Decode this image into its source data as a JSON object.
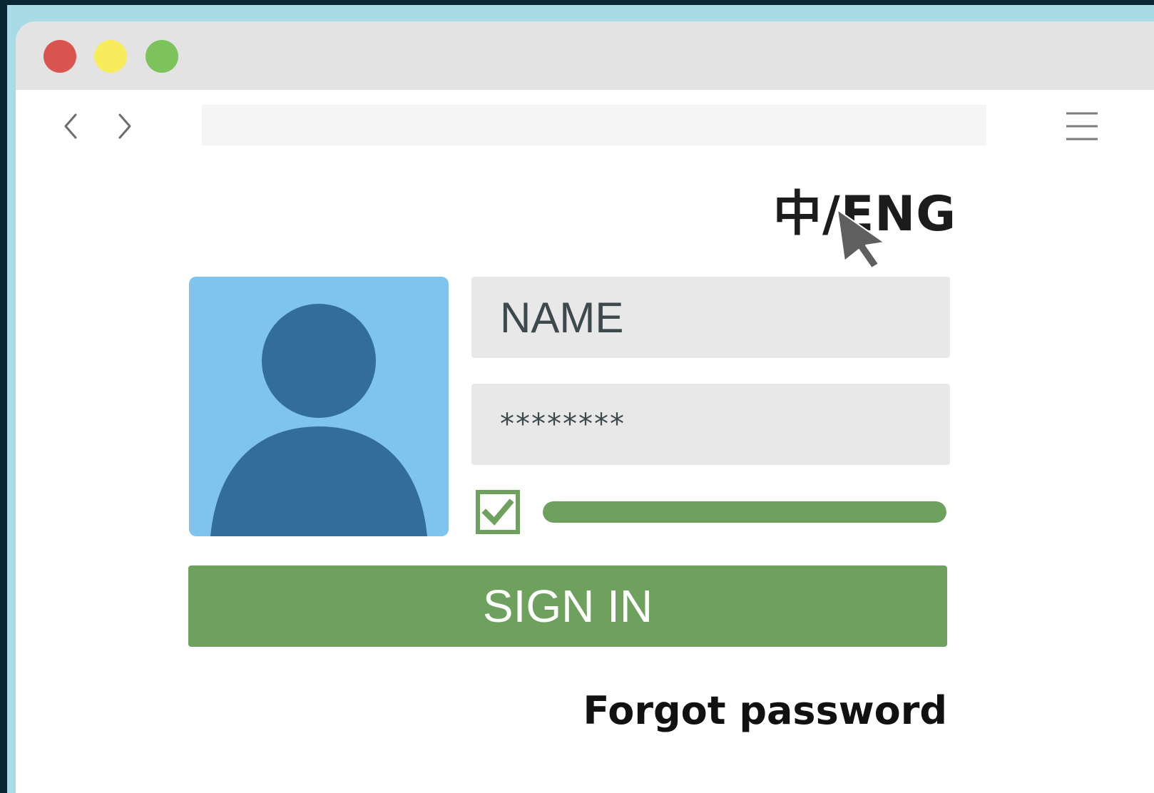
{
  "window": {
    "controls": [
      "close",
      "minimize",
      "maximize"
    ],
    "colors": {
      "close": "#d9534f",
      "minimize": "#f6ec5c",
      "maximize": "#7dc35b"
    }
  },
  "browser": {
    "address_value": "",
    "icons": {
      "back": "chevron-left-icon",
      "forward": "chevron-right-icon",
      "menu": "hamburger-menu-icon"
    }
  },
  "language_toggle": {
    "label": "中/ENG"
  },
  "login_form": {
    "avatar_icon": "user-avatar-icon",
    "name_field": {
      "value": "NAME"
    },
    "password_field": {
      "value": "********"
    },
    "remember_checkbox": {
      "checked": true
    },
    "progress": {
      "percent": 100
    },
    "signin_button": {
      "label": "SIGN IN"
    },
    "forgot_link": {
      "label": "Forgot password"
    }
  },
  "colors": {
    "accent_green": "#6ea15e",
    "avatar_bg": "#7fc4ee",
    "avatar_figure": "#336d9c",
    "frame_bg": "#a9dbe6"
  }
}
